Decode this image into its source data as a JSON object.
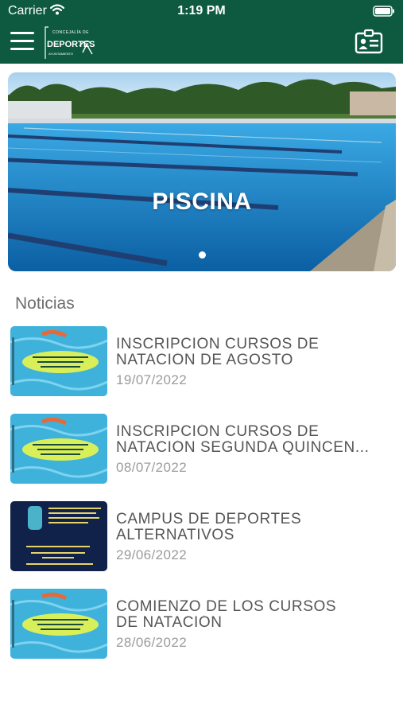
{
  "status_bar": {
    "carrier": "Carrier",
    "time": "1:19 PM"
  },
  "header": {
    "logo": {
      "top_text": "CONCEJALÍA DE",
      "main_text": "DEPORTES",
      "sub_text": "AYUNTAMIENTO"
    },
    "menu_icon": "hamburger-menu-icon",
    "right_icon": "id-card-icon"
  },
  "slider": {
    "title": "PISCINA",
    "active_index": 0,
    "count": 1
  },
  "news": {
    "section_title": "Noticias",
    "items": [
      {
        "title_line1": "INSCRIPCIÓN CURSOS DE",
        "title_line2": "NATACIÓN DE AGOSTO",
        "date": "19/07/2022",
        "thumb_type": "pool"
      },
      {
        "title_line1": " INSCRIPCIÓN CURSOS DE",
        "title_line2": "NATACIÓN SEGUNDA QUINCEN...",
        "date": "08/07/2022",
        "thumb_type": "pool"
      },
      {
        "title_line1": "CAMPUS DE DEPORTES",
        "title_line2": "ALTERNATIVOS",
        "date": "29/06/2022",
        "thumb_type": "info"
      },
      {
        "title_line1": "COMIENZO DE LOS CURSOS",
        "title_line2": "DE NATACIÓN",
        "date": "28/06/2022",
        "thumb_type": "pool"
      }
    ]
  },
  "colors": {
    "header_bg": "#0d5a41",
    "title_text": "#555555",
    "date_text": "#9b9b9b",
    "section_text": "#6d6d6d"
  }
}
